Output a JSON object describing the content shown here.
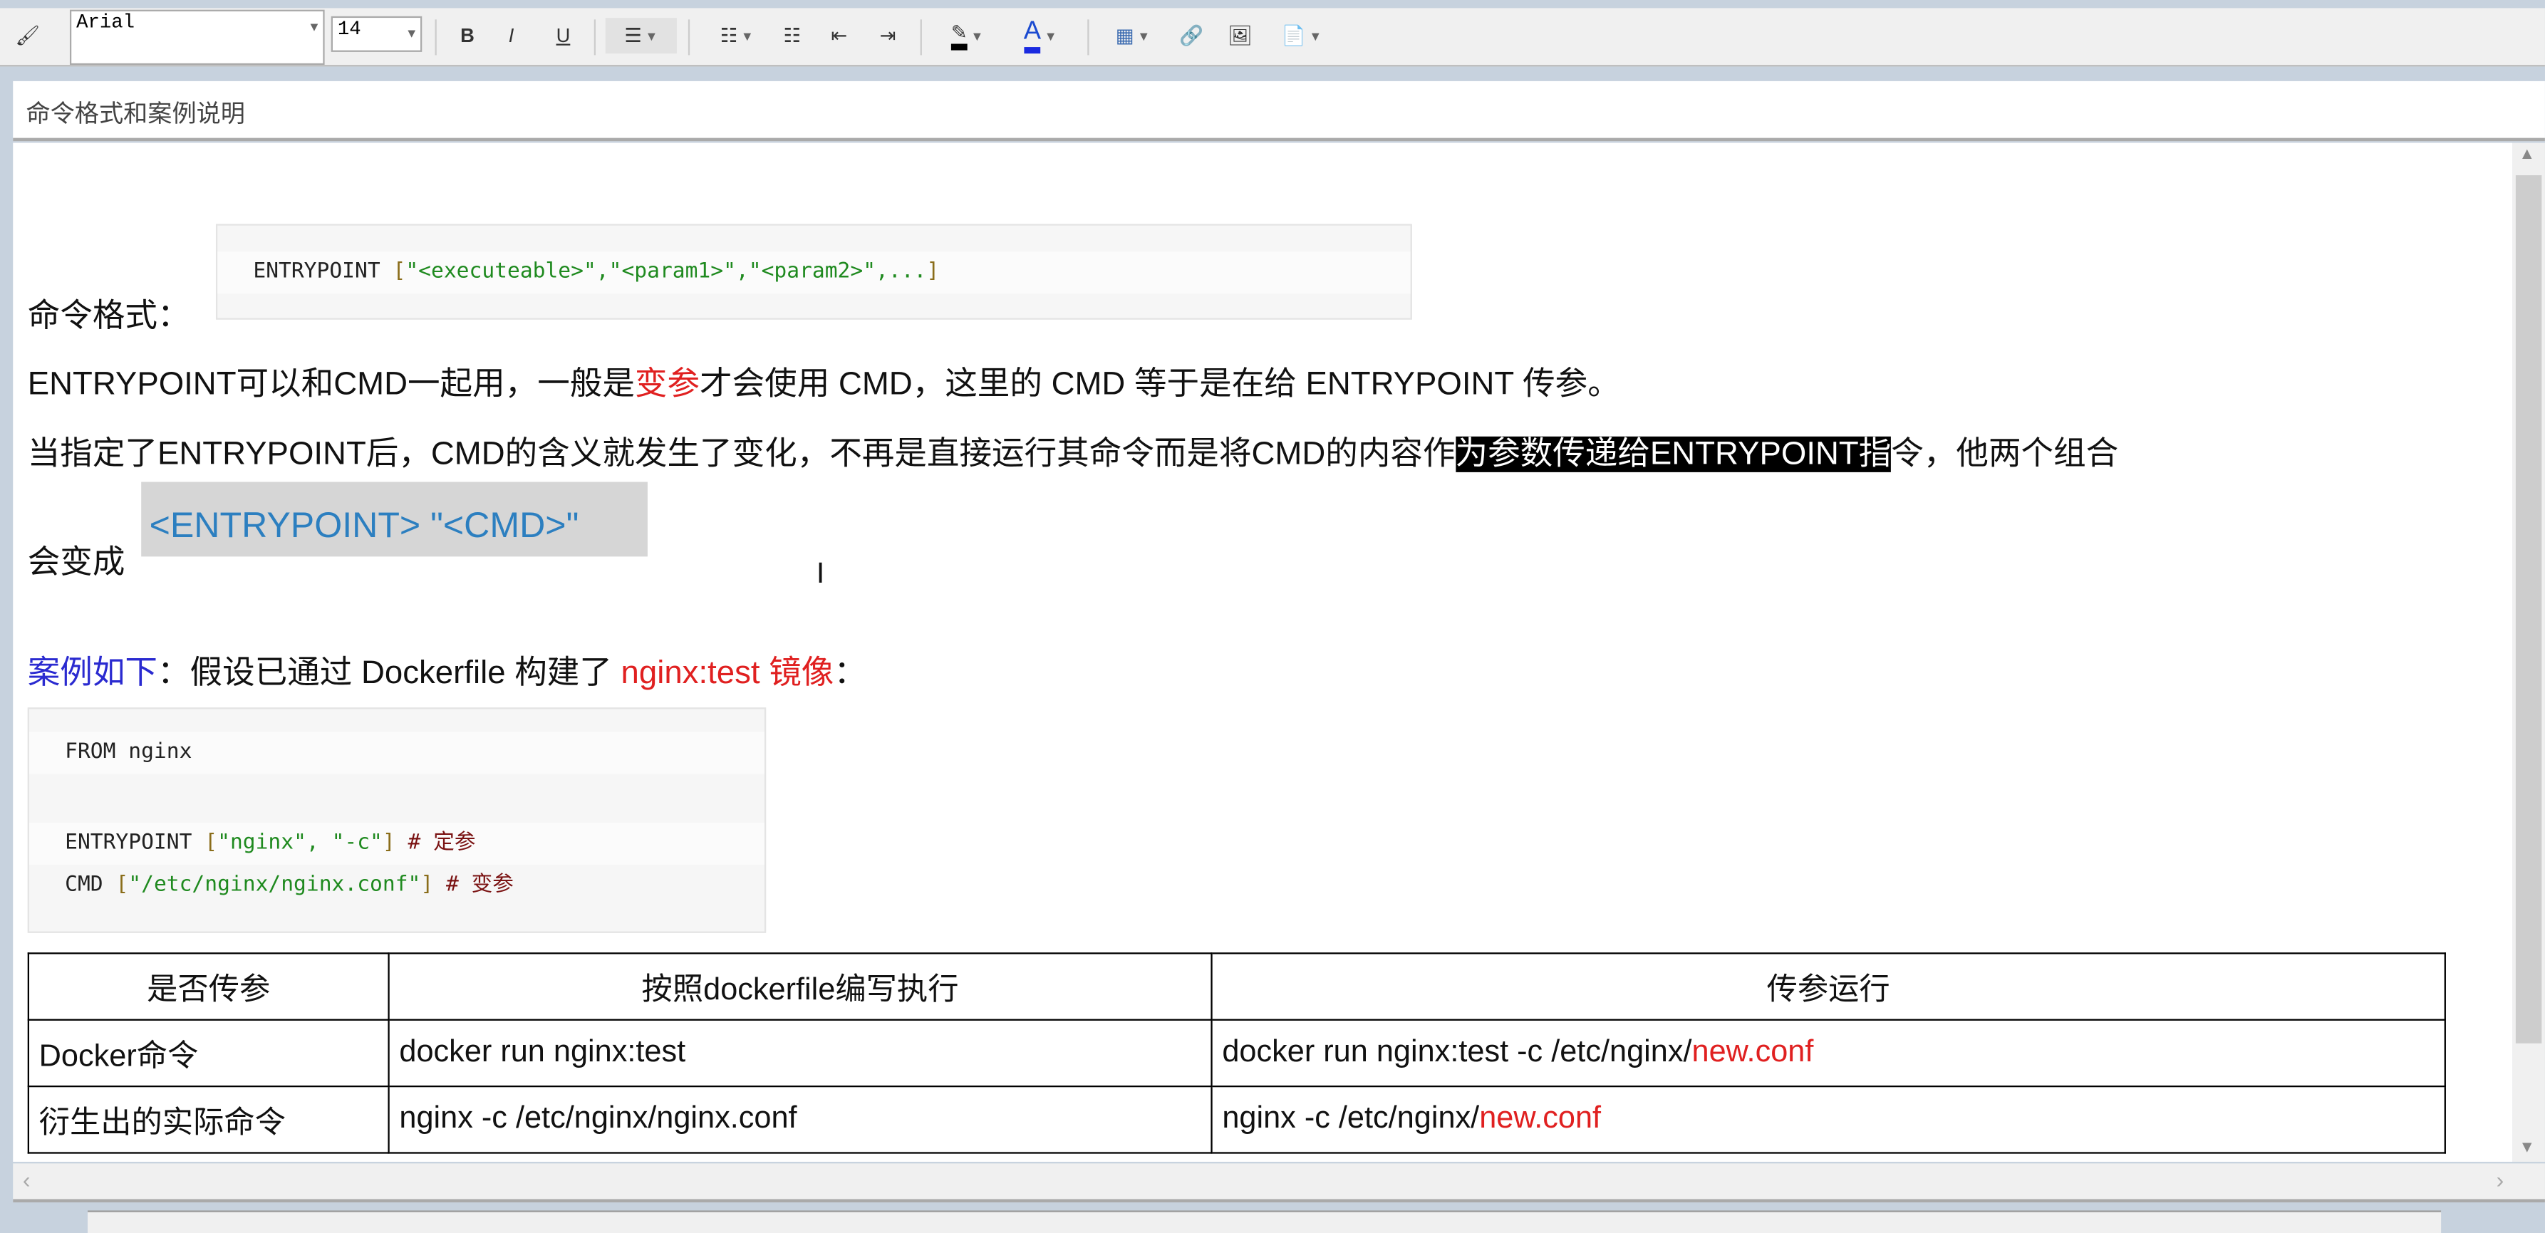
{
  "toolbar": {
    "font": "Arial",
    "size": "14",
    "bold": "B",
    "italic": "I",
    "underline": "U"
  },
  "title": "命令格式和案例说明",
  "doc": {
    "format_label": "命令格式：",
    "code1": {
      "kw": "ENTRYPOINT",
      "args": "\"<executeable>\",\"<param1>\",\"<param2>\",..."
    },
    "p1": {
      "a": "ENTRYPOINT可以和CMD一起用，一般是",
      "red": "变参",
      "b": "才会使用 CMD，这里的 CMD 等于是在给 ENTRYPOINT 传参。"
    },
    "p2": {
      "a": "当指定了ENTRYPOINT后，CMD的含义就发生了变化，不再是直接运行其命令而是将CMD的内容作",
      "hl": "为参数传递给ENTRYPOINT指",
      "b": "令，他两个组合"
    },
    "p3": "会变成",
    "combo": "<ENTRYPOINT> \"<CMD>\"",
    "p4": {
      "blue": "案例如下",
      "a": "：假设已通过 Dockerfile 构建了 ",
      "red": "nginx:test 镜像",
      "b": "："
    },
    "code2": {
      "l1": "FROM nginx",
      "l3kw": "ENTRYPOINT",
      "l3args": "\"nginx\", \"-c\"",
      "l3cm": "# 定参",
      "l4kw": "CMD",
      "l4args": "\"/etc/nginx/nginx.conf\"",
      "l4cm": "# 变参"
    },
    "table": {
      "headers": [
        "是否传参",
        "按照dockerfile编写执行",
        "传参运行"
      ],
      "rows": [
        {
          "label": "Docker命令",
          "c1": "docker run  nginx:test",
          "c2a": "docker run  nginx:test -c /etc/nginx/",
          "c2red": "new.conf"
        },
        {
          "label": "衍生出的实际命令",
          "c1": "nginx -c /etc/nginx/nginx.conf",
          "c2a": "nginx -c /etc/nginx/",
          "c2red": "new.conf"
        }
      ]
    }
  }
}
